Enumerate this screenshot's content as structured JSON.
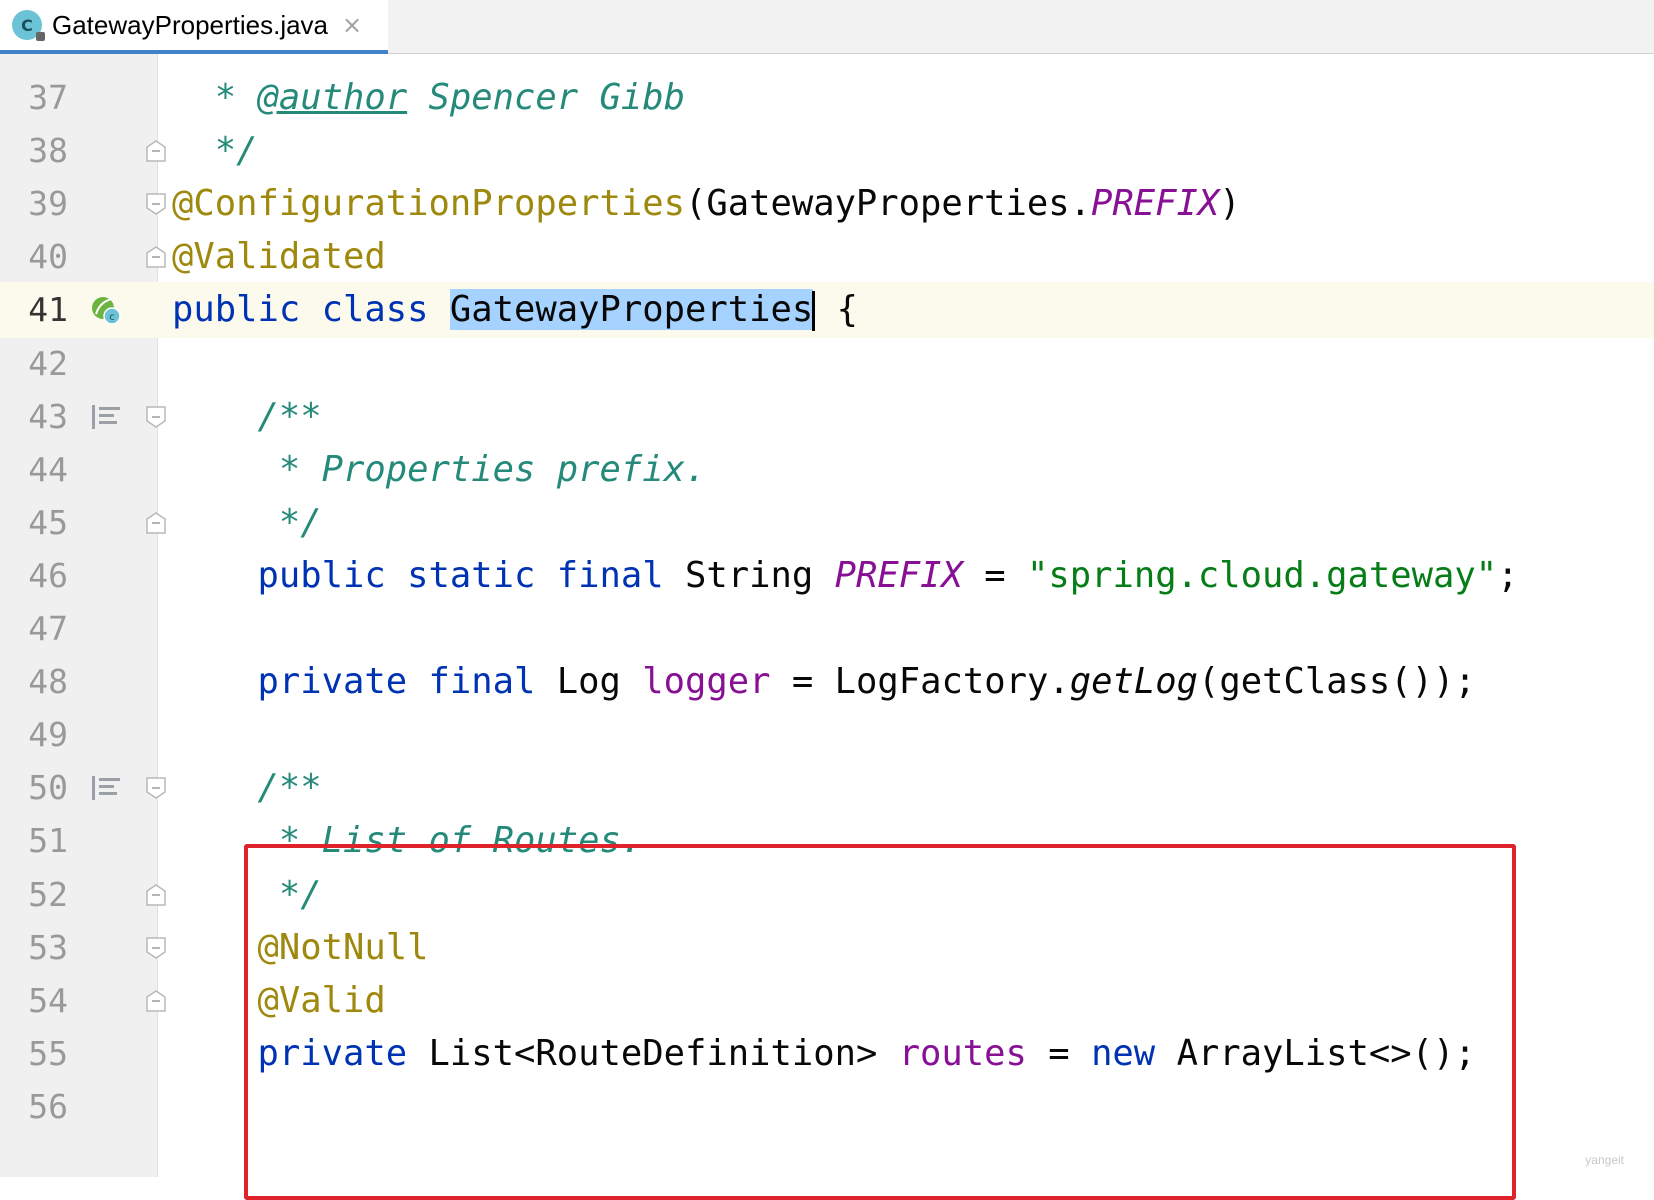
{
  "tab": {
    "title": "GatewayProperties.java",
    "icon_letter": "C",
    "close": "×"
  },
  "watermark": "yangeit",
  "lines": [
    {
      "num": "37",
      "tokens": [
        [
          "cmt",
          "  * "
        ],
        [
          "tag",
          "@author"
        ],
        [
          "cmt",
          " Spencer Gibb"
        ]
      ]
    },
    {
      "num": "38",
      "tokens": [
        [
          "cmt",
          "  */"
        ]
      ]
    },
    {
      "num": "39",
      "tokens": [
        [
          "ann",
          "@ConfigurationProperties"
        ],
        [
          "",
          "(GatewayProperties."
        ],
        [
          "const",
          "PREFIX"
        ],
        [
          "",
          ")"
        ]
      ]
    },
    {
      "num": "40",
      "tokens": [
        [
          "ann",
          "@Validated"
        ]
      ]
    },
    {
      "num": "41",
      "tokens": [
        [
          "kw",
          "public class "
        ],
        [
          "sel",
          "GatewayProperties"
        ],
        [
          "caret",
          ""
        ],
        [
          "",
          " {"
        ]
      ]
    },
    {
      "num": "42",
      "tokens": []
    },
    {
      "num": "43",
      "tokens": [
        [
          "cmt",
          "    /**"
        ]
      ]
    },
    {
      "num": "44",
      "tokens": [
        [
          "cmt",
          "     * Properties prefix."
        ]
      ]
    },
    {
      "num": "45",
      "tokens": [
        [
          "cmt",
          "     */"
        ]
      ]
    },
    {
      "num": "46",
      "tokens": [
        [
          "kw",
          "    public static final "
        ],
        [
          "",
          "String "
        ],
        [
          "const",
          "PREFIX"
        ],
        [
          "",
          " = "
        ],
        [
          "str",
          "\"spring.cloud.gateway\""
        ],
        [
          "",
          ";"
        ]
      ]
    },
    {
      "num": "47",
      "tokens": []
    },
    {
      "num": "48",
      "tokens": [
        [
          "kw",
          "    private final "
        ],
        [
          "",
          "Log "
        ],
        [
          "field",
          "logger"
        ],
        [
          "",
          " = LogFactory."
        ],
        [
          "meth",
          "getLog"
        ],
        [
          "",
          "(getClass());"
        ]
      ]
    },
    {
      "num": "49",
      "tokens": []
    },
    {
      "num": "50",
      "tokens": [
        [
          "cmt",
          "    /**"
        ]
      ]
    },
    {
      "num": "51",
      "tokens": [
        [
          "cmt",
          "     * List of Routes."
        ]
      ]
    },
    {
      "num": "52",
      "tokens": [
        [
          "cmt",
          "     */"
        ]
      ]
    },
    {
      "num": "53",
      "tokens": [
        [
          "ann",
          "    @NotNull"
        ]
      ]
    },
    {
      "num": "54",
      "tokens": [
        [
          "ann",
          "    @Valid"
        ]
      ]
    },
    {
      "num": "55",
      "tokens": [
        [
          "kw",
          "    private "
        ],
        [
          "",
          "List<RouteDefinition> "
        ],
        [
          "field",
          "routes"
        ],
        [
          "",
          " = "
        ],
        [
          "kw",
          "new "
        ],
        [
          "",
          "ArrayList<>();"
        ]
      ]
    },
    {
      "num": "56",
      "tokens": []
    }
  ],
  "current_line": "41",
  "gutter_icons": {
    "41": "spring-bean-class-icon",
    "43": "rendered-doc-icon",
    "50": "rendered-doc-icon"
  },
  "fold_markers": {
    "38": "fold-end",
    "39": "fold-start",
    "40": "fold-end",
    "43": "fold-start",
    "45": "fold-end",
    "50": "fold-start",
    "52": "fold-end",
    "53": "fold-start",
    "54": "fold-end"
  }
}
